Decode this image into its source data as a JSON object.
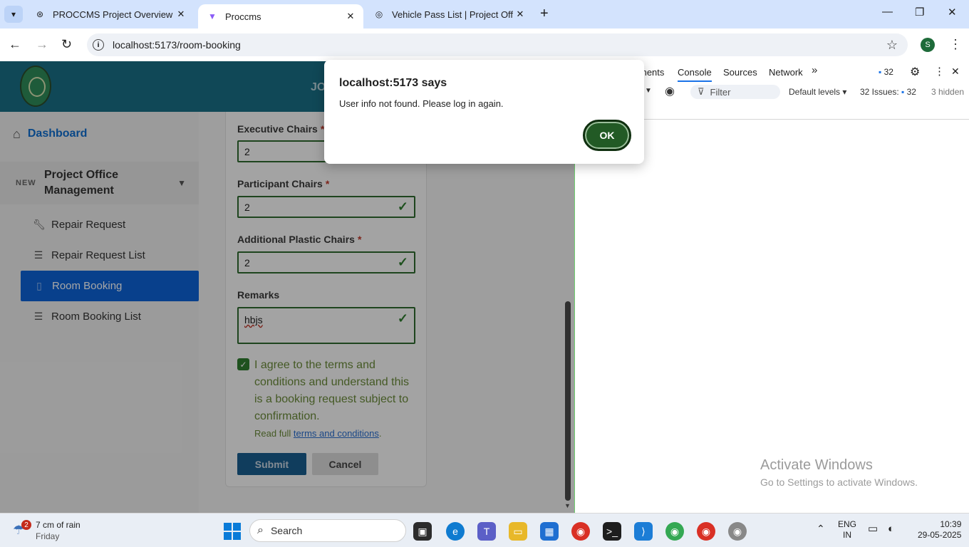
{
  "browser": {
    "tabs": [
      {
        "title": "PROCCMS Project Overview",
        "icon": "openai-icon",
        "active": false
      },
      {
        "title": "Proccms",
        "icon": "vite-icon",
        "active": true
      },
      {
        "title": "Vehicle Pass List | Project Office",
        "icon": "globe-icon",
        "active": false
      }
    ],
    "url": "localhost:5173/room-booking",
    "profile_initial": "S"
  },
  "app": {
    "header_text": "JO",
    "sidebar": {
      "dashboard": "Dashboard",
      "group_badge": "NEW",
      "group_label": "Project Office Management",
      "items": [
        {
          "label": "Repair Request",
          "icon": "wrench-icon",
          "active": false
        },
        {
          "label": "Repair Request List",
          "icon": "list-icon",
          "active": false
        },
        {
          "label": "Room Booking",
          "icon": "document-icon",
          "active": true
        },
        {
          "label": "Room Booking List",
          "icon": "list-icon",
          "active": false
        }
      ]
    },
    "form": {
      "executive_chairs_label": "Executive Chairs",
      "executive_chairs_value": "2",
      "participant_chairs_label": "Participant Chairs",
      "participant_chairs_value": "2",
      "plastic_chairs_label": "Additional Plastic Chairs",
      "plastic_chairs_value": "2",
      "remarks_label": "Remarks",
      "remarks_value": "hbjs",
      "required_mark": "*",
      "agree_text": "I agree to the terms and conditions and understand this is a booking request subject to confirmation.",
      "read_full_prefix": "Read full ",
      "read_full_link": "terms and conditions",
      "read_full_suffix": ".",
      "submit_label": "Submit",
      "cancel_label": "Cancel"
    }
  },
  "alert": {
    "title": "localhost:5173 says",
    "message": "User info not found. Please log in again.",
    "ok_label": "OK"
  },
  "devtools": {
    "tabs": [
      "ments",
      "Console",
      "Sources",
      "Network"
    ],
    "active_tab": "Console",
    "message_count": "32",
    "filter_placeholder": "Filter",
    "levels_label": "Default levels ▾",
    "issues_label": "32 Issues:",
    "issues_count": "32",
    "hidden_label": "3 hidden"
  },
  "watermark": {
    "line1": "Activate Windows",
    "line2": "Go to Settings to activate Windows."
  },
  "taskbar": {
    "weather_text": "7 cm of rain",
    "weather_sub": "Friday",
    "weather_badge": "2",
    "search_label": "Search",
    "lang_line1": "ENG",
    "lang_line2": "IN",
    "time": "10:39",
    "date": "29-05-2025"
  }
}
